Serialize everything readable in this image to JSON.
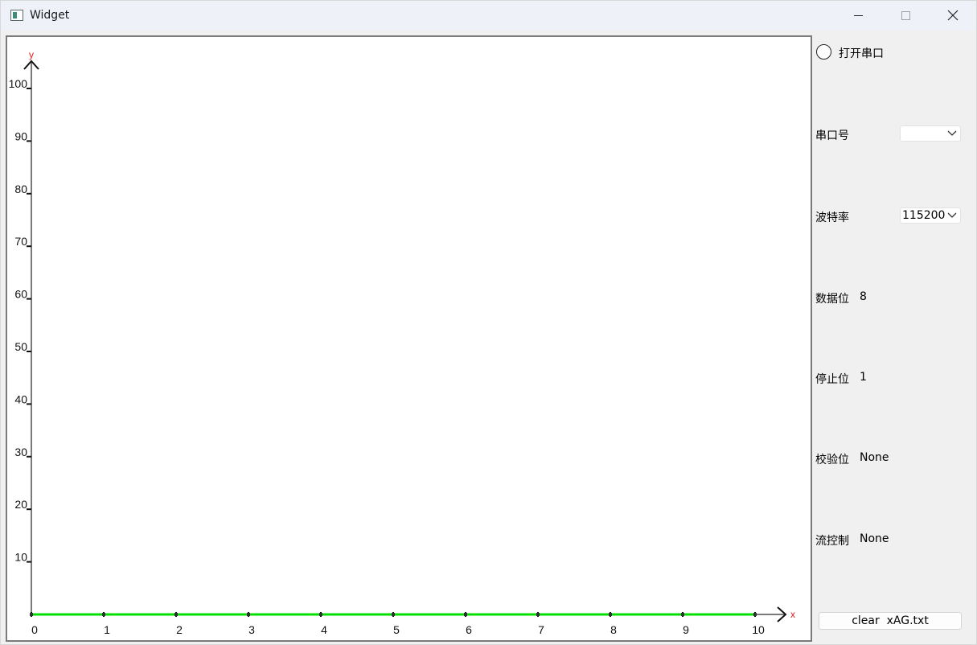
{
  "window": {
    "title": "Widget"
  },
  "title_buttons": {
    "minimize": "minimize-icon",
    "maximize": "maximize-icon",
    "close": "close-icon"
  },
  "chart_data": {
    "type": "line",
    "xlabel": "x",
    "ylabel": "y",
    "xlim": [
      0,
      10
    ],
    "ylim": [
      0,
      100
    ],
    "x_ticks": [
      0,
      1,
      2,
      3,
      4,
      5,
      6,
      7,
      8,
      9,
      10
    ],
    "x_tick_labels": [
      "0",
      "1",
      "2",
      "3",
      "4",
      "5",
      "6",
      "7",
      "8",
      "9",
      "10"
    ],
    "y_ticks": [
      10,
      20,
      30,
      40,
      50,
      60,
      70,
      80,
      90,
      100
    ],
    "y_tick_labels": [
      "10",
      "20",
      "30",
      "40",
      "50",
      "60",
      "70",
      "80",
      "90",
      "100"
    ],
    "series": [
      {
        "color": "#00e000",
        "x": [
          0,
          1,
          2,
          3,
          4,
          5,
          6,
          7,
          8,
          9,
          10
        ],
        "y": [
          0,
          0,
          0,
          0,
          0,
          0,
          0,
          0,
          0,
          0,
          0
        ]
      }
    ],
    "axis_color": "#7a7a7a",
    "axis_name_color": "#e02020"
  },
  "serial": {
    "open_label": "打开串口",
    "port_label": "串口号",
    "port_value": "",
    "baud_label": "波特率",
    "baud_value": "115200",
    "databits_label": "数据位",
    "databits_value": "8",
    "stopbits_label": "停止位",
    "stopbits_value": "1",
    "parity_label": "校验位",
    "parity_value": "None",
    "flow_label": "流控制",
    "flow_value": "None",
    "clear_label": "clear  xAG.txt"
  }
}
